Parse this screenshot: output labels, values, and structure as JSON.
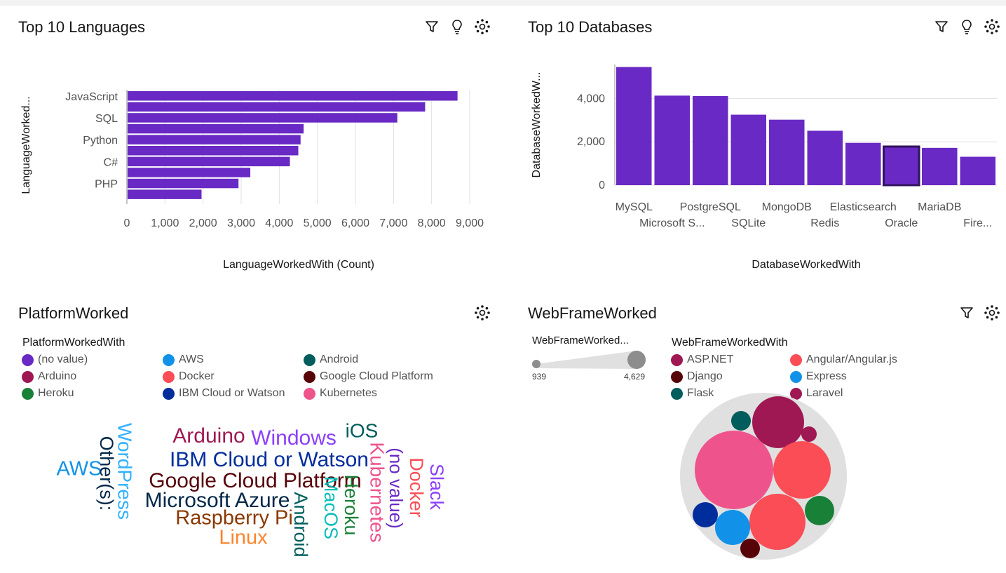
{
  "languages": {
    "title": "Top 10 Languages",
    "chart_data": {
      "type": "bar",
      "orientation": "horizontal",
      "categories": [
        "JavaScript",
        "",
        "SQL",
        "",
        "Python",
        "",
        "C#",
        "",
        "PHP",
        ""
      ],
      "values": [
        8680,
        7830,
        7100,
        4640,
        4560,
        4500,
        4280,
        3240,
        2930,
        1960
      ],
      "xlim": [
        0,
        9000
      ],
      "xticks": [
        "0",
        "1,000",
        "2,000",
        "3,000",
        "4,000",
        "5,000",
        "6,000",
        "7,000",
        "8,000",
        "9,000"
      ],
      "xlabel": "LanguageWorkedWith (Count)",
      "ylabel": "LanguageWorked...",
      "color": "#6929c4",
      "grid": true
    }
  },
  "databases": {
    "title": "Top 10 Databases",
    "chart_data": {
      "type": "bar",
      "categories": [
        "MySQL",
        "Microsoft S...",
        "PostgreSQL",
        "SQLite",
        "MongoDB",
        "Redis",
        "Elasticsearch",
        "Oracle",
        "MariaDB",
        "Fire..."
      ],
      "values": [
        5450,
        4130,
        4110,
        3250,
        3020,
        2510,
        1950,
        1780,
        1720,
        1310
      ],
      "ylim": [
        0,
        5500
      ],
      "yticks": [
        "0",
        "2,000",
        "4,000"
      ],
      "xlabel": "DatabaseWorkedWith",
      "ylabel": "DatabaseWorkedW...",
      "color": "#6929c4",
      "selected_index": 7,
      "grid": true
    }
  },
  "platform": {
    "title": "PlatformWorked",
    "legend_title": "PlatformWorkedWith",
    "legend": [
      {
        "label": "(no value)",
        "color": "#6929c4"
      },
      {
        "label": "AWS",
        "color": "#1192e8"
      },
      {
        "label": "Android",
        "color": "#005d5d"
      },
      {
        "label": "Arduino",
        "color": "#9f1853"
      },
      {
        "label": "Docker",
        "color": "#fa4d56"
      },
      {
        "label": "Google Cloud Platform",
        "color": "#570408"
      },
      {
        "label": "Heroku",
        "color": "#198038"
      },
      {
        "label": "IBM Cloud or Watson",
        "color": "#002d9c"
      },
      {
        "label": "Kubernetes",
        "color": "#ee538b"
      }
    ],
    "words": [
      {
        "text": "Arduino",
        "color": "#9f1853"
      },
      {
        "text": "Windows",
        "color": "#8a3ffc"
      },
      {
        "text": "iOS",
        "color": "#005d5d"
      },
      {
        "text": "IBM Cloud or Watson",
        "color": "#002d9c"
      },
      {
        "text": "AWS",
        "color": "#1192e8"
      },
      {
        "text": "Google Cloud Platform",
        "color": "#570408"
      },
      {
        "text": "Microsoft Azure",
        "color": "#012749"
      },
      {
        "text": "Raspberry Pi",
        "color": "#8a3800"
      },
      {
        "text": "Linux",
        "color": "#ff832b"
      },
      {
        "text": "WordPress",
        "color": "#33b1ff"
      },
      {
        "text": "Other(s):",
        "color": "#012749"
      },
      {
        "text": "Android",
        "color": "#005d5d"
      },
      {
        "text": "MacOS",
        "color": "#08bdba"
      },
      {
        "text": "Heroku",
        "color": "#198038"
      },
      {
        "text": "Kubernetes",
        "color": "#ee538b"
      },
      {
        "text": "(no value)",
        "color": "#6929c4"
      },
      {
        "text": "Docker",
        "color": "#fa4d56"
      },
      {
        "text": "Slack",
        "color": "#8a3ffc"
      }
    ]
  },
  "webframe": {
    "title": "WebFrameWorked",
    "size_legend_title": "WebFrameWorked...",
    "size_min": "939",
    "size_max": "4,629",
    "legend_title": "WebFrameWorkedWith",
    "legend": [
      {
        "label": "ASP.NET",
        "color": "#9f1853"
      },
      {
        "label": "Angular/Angular.js",
        "color": "#fa4d56"
      },
      {
        "label": "Django",
        "color": "#570408"
      },
      {
        "label": "Express",
        "color": "#1192e8"
      },
      {
        "label": "Flask",
        "color": "#005d5d"
      },
      {
        "label": "Laravel",
        "color": "#9f1853"
      }
    ],
    "bubbles": [
      {
        "color": "#ee538b"
      },
      {
        "color": "#9f1853"
      },
      {
        "color": "#fa4d56"
      },
      {
        "color": "#fa4d56"
      },
      {
        "color": "#005d5d"
      },
      {
        "color": "#9f1853"
      },
      {
        "color": "#002d9c"
      },
      {
        "color": "#1192e8"
      },
      {
        "color": "#198038"
      },
      {
        "color": "#570408"
      }
    ]
  }
}
